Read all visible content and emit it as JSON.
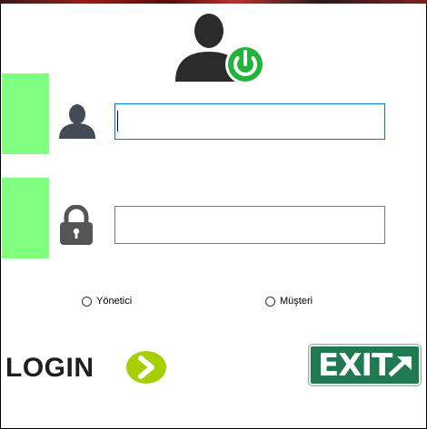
{
  "login_form": {
    "username": {
      "value": "",
      "icon": "user-icon"
    },
    "password": {
      "value": "",
      "icon": "lock-icon"
    },
    "roles": [
      {
        "label": "Yönetici",
        "selected": false
      },
      {
        "label": "Müşteri",
        "selected": false
      }
    ],
    "login_button": {
      "label": "LOGIN",
      "icon": "chevron-right-icon"
    },
    "exit_button": {
      "label": "EXIT",
      "icon": "arrow-up-right-icon"
    }
  },
  "colors": {
    "side_blocks": "#80ff80",
    "power_badge": "#22b33a",
    "login_arrow": "#a6ce00",
    "exit_sign": "#1f7a52",
    "focus_border": "#0078d7"
  }
}
